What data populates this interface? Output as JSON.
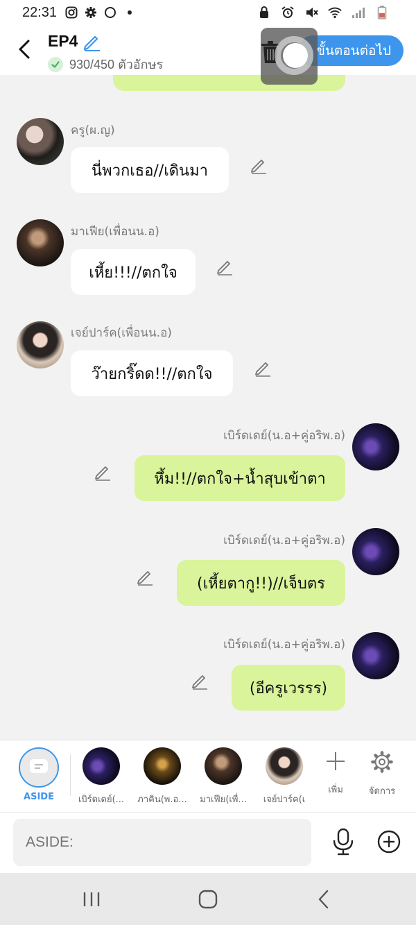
{
  "status_bar": {
    "time": "22:31"
  },
  "header": {
    "title": "EP4",
    "char_count": "930/450 ตัวอักษร",
    "next_label": "ขั้นตอนต่อไป"
  },
  "messages": [
    {
      "side": "left",
      "name": "ครู(ผ.ญ)",
      "text": "นี่พวกเธอ//เดินมา",
      "avatar": "av-girl"
    },
    {
      "side": "left",
      "name": "มาเฟีย(เพื่อนน.อ)",
      "text": "เหี้ย!!!//ตกใจ",
      "avatar": "av-dark"
    },
    {
      "side": "left",
      "name": "เจย์ปาร์ค(เพื่อนน.อ)",
      "text": "ว๊ายกริ๊ดด!!//ตกใจ",
      "avatar": "av-boy"
    },
    {
      "side": "right",
      "name": "เบิร์ดเดย์(น.อ+คู่อริพ.อ)",
      "text": "หึ้ม!!//ตกใจ+น้ำสุบเข้าตา",
      "avatar": "av-purple"
    },
    {
      "side": "right",
      "name": "เบิร์ดเดย์(น.อ+คู่อริพ.อ)",
      "text": "(เหี้ยตากู!!)//เจ็บตร",
      "avatar": "av-purple"
    },
    {
      "side": "right",
      "name": "เบิร์ดเดย์(น.อ+คู่อริพ.อ)",
      "text": "(อีครูเวรรร)",
      "avatar": "av-purple"
    }
  ],
  "character_bar": {
    "aside_label": "ASIDE",
    "characters": [
      {
        "label": "เบิร์ดเดย์(...",
        "avatar": "av-purple"
      },
      {
        "label": "ภาคิน(พ.อ...",
        "avatar": "av-gold"
      },
      {
        "label": "มาเฟีย(เพื่...",
        "avatar": "av-dark"
      },
      {
        "label": "เจย์ปาร์ค(เ",
        "avatar": "av-boy"
      }
    ],
    "add_label": "เพิ่ม",
    "manage_label": "จัดการ"
  },
  "input": {
    "placeholder": "ASIDE:"
  },
  "colors": {
    "accent": "#3d96ec",
    "my_bubble": "#d9f49a",
    "other_bubble": "#ffffff",
    "check": "#3cb55a"
  }
}
